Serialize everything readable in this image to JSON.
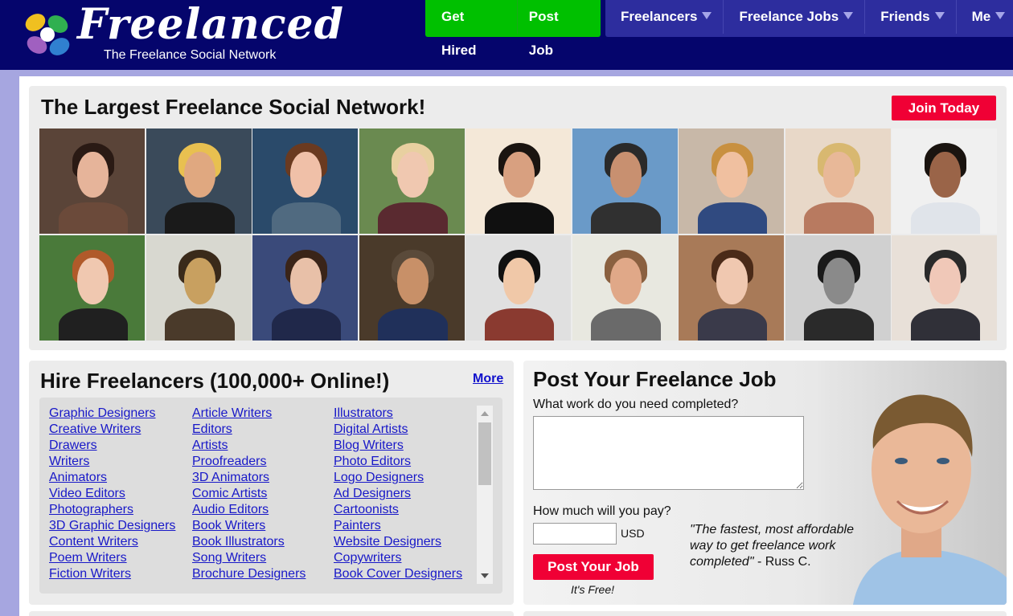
{
  "header": {
    "logo": {
      "word": "Freelanced",
      "tagline": "The Freelance Social Network"
    },
    "green_nav": [
      {
        "label": "Get Hired"
      },
      {
        "label": "Post Job"
      }
    ],
    "blue_nav": [
      {
        "label": "Freelancers",
        "icon": "caret-down-icon"
      },
      {
        "label": "Freelance Jobs",
        "icon": "caret-down-icon"
      },
      {
        "label": "Friends",
        "icon": "caret-down-icon"
      },
      {
        "label": "Me",
        "icon": "caret-down-icon"
      }
    ]
  },
  "hero": {
    "title": "The Largest Freelance Social Network!",
    "join_label": "Join Today"
  },
  "hire": {
    "title": "Hire Freelancers (100,000+ Online!)",
    "more_label": "More",
    "columns": [
      [
        "Graphic Designers",
        "Creative Writers",
        "Drawers",
        "Writers",
        "Animators",
        "Video Editors",
        "Photographers",
        "3D Graphic Designers",
        "Content Writers",
        "Poem Writers",
        "Fiction Writers"
      ],
      [
        "Article Writers",
        "Editors",
        "Artists",
        "Proofreaders",
        "3D Animators",
        "Comic Artists",
        "Audio Editors",
        "Book Writers",
        "Book Illustrators",
        "Song Writers",
        "Brochure Designers"
      ],
      [
        "Illustrators",
        "Digital Artists",
        "Blog Writers",
        "Photo Editors",
        "Logo Designers",
        "Ad Designers",
        "Cartoonists",
        "Painters",
        "Website Designers",
        "Copywriters",
        "Book Cover Designers"
      ]
    ]
  },
  "post": {
    "title": "Post Your Freelance Job",
    "question_work": "What work do you need completed?",
    "work_value": "",
    "question_pay": "How much will you pay?",
    "pay_value": "",
    "currency": "USD",
    "button_label": "Post Your Job",
    "free_note": "It's Free!",
    "quote": "\"The fastest, most affordable way to get freelance work completed\"",
    "quote_author": " - Russ C."
  },
  "colors": {
    "header_bg": "#05056c",
    "green_nav": "#00c000",
    "blue_nav": "#2d2d9e",
    "accent_red": "#f00035",
    "link": "#1818c8"
  }
}
